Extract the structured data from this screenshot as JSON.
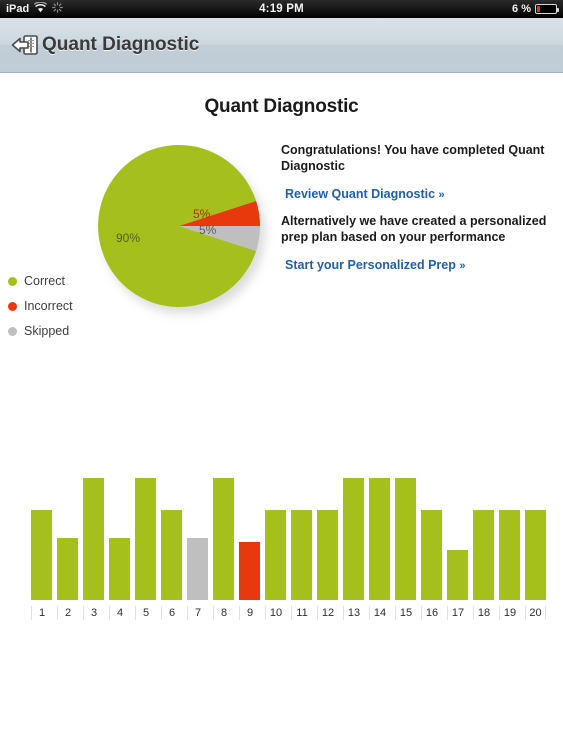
{
  "status_bar": {
    "carrier": "iPad",
    "wifi_icon": "wifi-icon",
    "activity_icon": "activity-spinner-icon",
    "time": "4:19 PM",
    "battery_percent": "6 %",
    "battery_icon": "battery-icon"
  },
  "navbar": {
    "back_icon": "back-arrow-panel-icon",
    "title": "Quant Diagnostic"
  },
  "page": {
    "title": "Quant Diagnostic"
  },
  "legend": {
    "items": [
      {
        "label": "Correct",
        "color": "#A5C01C"
      },
      {
        "label": "Incorrect",
        "color": "#E8380D"
      },
      {
        "label": "Skipped",
        "color": "#BFBFBF"
      }
    ]
  },
  "info": {
    "congrats": "Congratulations! You have completed Quant Diagnostic",
    "review_link": "Review Quant Diagnostic",
    "alternative": "Alternatively we have created a personalized prep plan based on your performance",
    "prep_link": "Start your Personalized Prep",
    "chevron": "»"
  },
  "colors": {
    "correct": "#A5C01C",
    "incorrect": "#E8380D",
    "skipped": "#BFBFBF",
    "link": "#1F5FAD"
  },
  "chart_data": [
    {
      "type": "pie",
      "title": "Quant Diagnostic",
      "categories": [
        "Correct",
        "Incorrect",
        "Skipped"
      ],
      "values": [
        90,
        5,
        5
      ],
      "labels": [
        "90%",
        "5%",
        "5%"
      ],
      "colors": [
        "#A5C01C",
        "#E8380D",
        "#BFBFBF"
      ],
      "legend_position": "left",
      "start_angle_deg": -18,
      "units": "percent"
    },
    {
      "type": "bar",
      "title": "",
      "xlabel": "",
      "ylabel": "",
      "grid": false,
      "categories": [
        "1",
        "2",
        "3",
        "4",
        "5",
        "6",
        "7",
        "8",
        "9",
        "10",
        "11",
        "12",
        "13",
        "14",
        "15",
        "16",
        "17",
        "18",
        "19",
        "20"
      ],
      "values": [
        90,
        62,
        122,
        62,
        122,
        90,
        62,
        122,
        58,
        90,
        90,
        90,
        122,
        122,
        122,
        90,
        50,
        90,
        90,
        90
      ],
      "statuses": [
        "correct",
        "correct",
        "correct",
        "correct",
        "correct",
        "correct",
        "skipped",
        "correct",
        "incorrect",
        "correct",
        "correct",
        "correct",
        "correct",
        "correct",
        "correct",
        "correct",
        "correct",
        "correct",
        "correct",
        "correct"
      ],
      "ylim": [
        0,
        122
      ],
      "legend_entries": [
        "Correct",
        "Incorrect",
        "Skipped"
      ]
    }
  ]
}
